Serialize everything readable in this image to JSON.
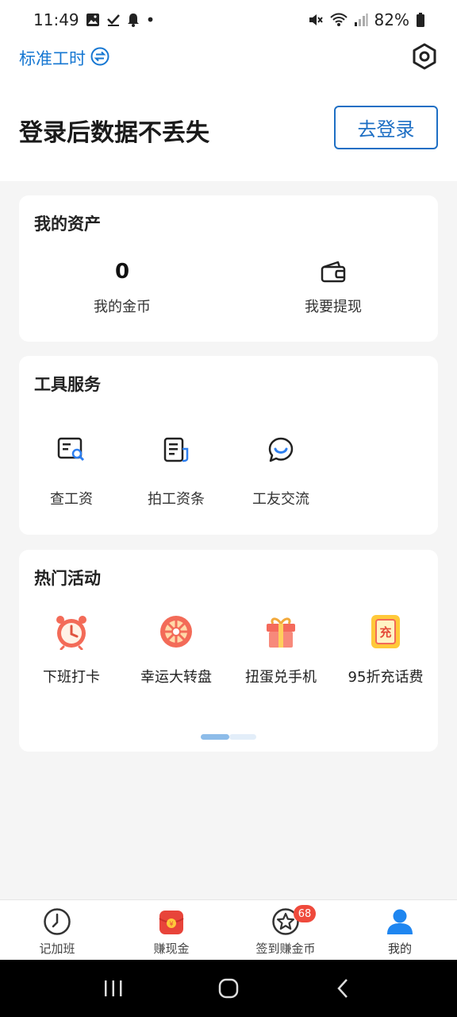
{
  "status_bar": {
    "time": "11:49",
    "dot": "•",
    "battery": "82%"
  },
  "header": {
    "work_type": "标准工时",
    "login_prompt": "登录后数据不丢失",
    "login_button": "去登录"
  },
  "assets": {
    "title": "我的资产",
    "coins_value": "0",
    "coins_label": "我的金币",
    "withdraw_label": "我要提现"
  },
  "tools": {
    "title": "工具服务",
    "items": [
      {
        "label": "查工资",
        "icon": "salary-search-icon"
      },
      {
        "label": "拍工资条",
        "icon": "payslip-icon"
      },
      {
        "label": "工友交流",
        "icon": "chat-smile-icon"
      }
    ]
  },
  "events": {
    "title": "热门活动",
    "items": [
      {
        "label": "下班打卡",
        "icon": "alarm-clock-icon"
      },
      {
        "label": "幸运大转盘",
        "icon": "lucky-wheel-icon"
      },
      {
        "label": "扭蛋兑手机",
        "icon": "gift-box-icon"
      },
      {
        "label": "95折充话费",
        "icon": "recharge-card-icon",
        "icon_text": "充"
      }
    ]
  },
  "tabbar": {
    "items": [
      {
        "label": "记加班",
        "icon": "clock-icon"
      },
      {
        "label": "赚现金",
        "icon": "red-envelope-icon"
      },
      {
        "label": "签到赚金币",
        "icon": "star-badge-icon",
        "badge": "68"
      },
      {
        "label": "我的",
        "icon": "user-icon"
      }
    ]
  },
  "colors": {
    "accent": "#1677d2",
    "badge": "#ef4a3c",
    "pager_active": "#8dbce9"
  }
}
